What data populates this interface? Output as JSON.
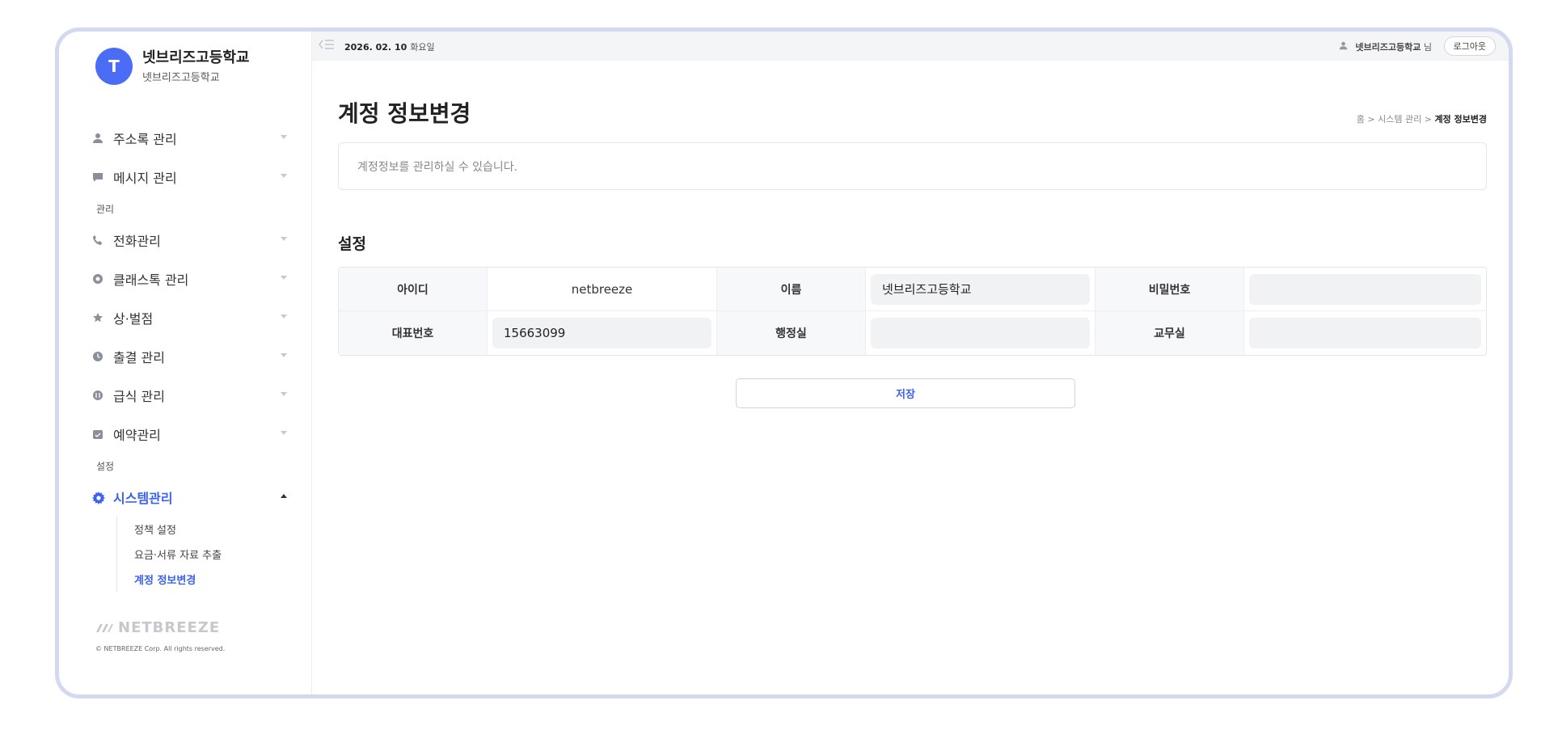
{
  "brand": {
    "avatar_letter": "T",
    "title": "넷브리즈고등학교",
    "subtitle": "넷브리즈고등학교"
  },
  "sidebar": {
    "items_top": [
      {
        "label": "주소록 관리",
        "icon": "person-icon"
      },
      {
        "label": "메시지 관리",
        "icon": "chat-icon"
      }
    ],
    "section_manage": "관리",
    "items_manage": [
      {
        "label": "전화관리",
        "icon": "phone-icon"
      },
      {
        "label": "클래스톡 관리",
        "icon": "classtalk-icon"
      },
      {
        "label": "상·벌점",
        "icon": "star-icon"
      },
      {
        "label": "출결 관리",
        "icon": "clock-icon"
      },
      {
        "label": "급식 관리",
        "icon": "meal-icon"
      },
      {
        "label": "예약관리",
        "icon": "calendar-icon"
      }
    ],
    "section_settings": "설정",
    "system": {
      "label": "시스템관리",
      "icon": "gear-icon"
    },
    "subitems": [
      "정책 설정",
      "요금·서류 자료 추출",
      "계정 정보변경"
    ],
    "footer_logo": "NETBREEZE",
    "footer_copy": "© NETBREEZE Corp. All rights reserved."
  },
  "topbar": {
    "date": "2026. 02. 10",
    "weekday": "화요일",
    "user_name": "넷브리즈고등학교",
    "user_suffix": "님",
    "logout": "로그아웃"
  },
  "page": {
    "title": "계정 정보변경",
    "breadcrumb": {
      "home": "홈",
      "sep": ">",
      "parent": "시스템 관리",
      "current": "계정 정보변경"
    },
    "description": "계정정보를 관리하실 수 있습니다.",
    "section_title": "설정"
  },
  "form": {
    "id_label": "아이디",
    "id_value": "netbreeze",
    "name_label": "이름",
    "name_value": "넷브리즈고등학교",
    "password_label": "비밀번호",
    "password_value": "",
    "rep_label": "대표번호",
    "rep_value": "15663099",
    "admin_label": "행정실",
    "admin_value": "",
    "staff_label": "교무실",
    "staff_value": ""
  },
  "save_label": "저장",
  "colors": {
    "accent": "#3d62f0",
    "frame": "#d2d9f0"
  }
}
